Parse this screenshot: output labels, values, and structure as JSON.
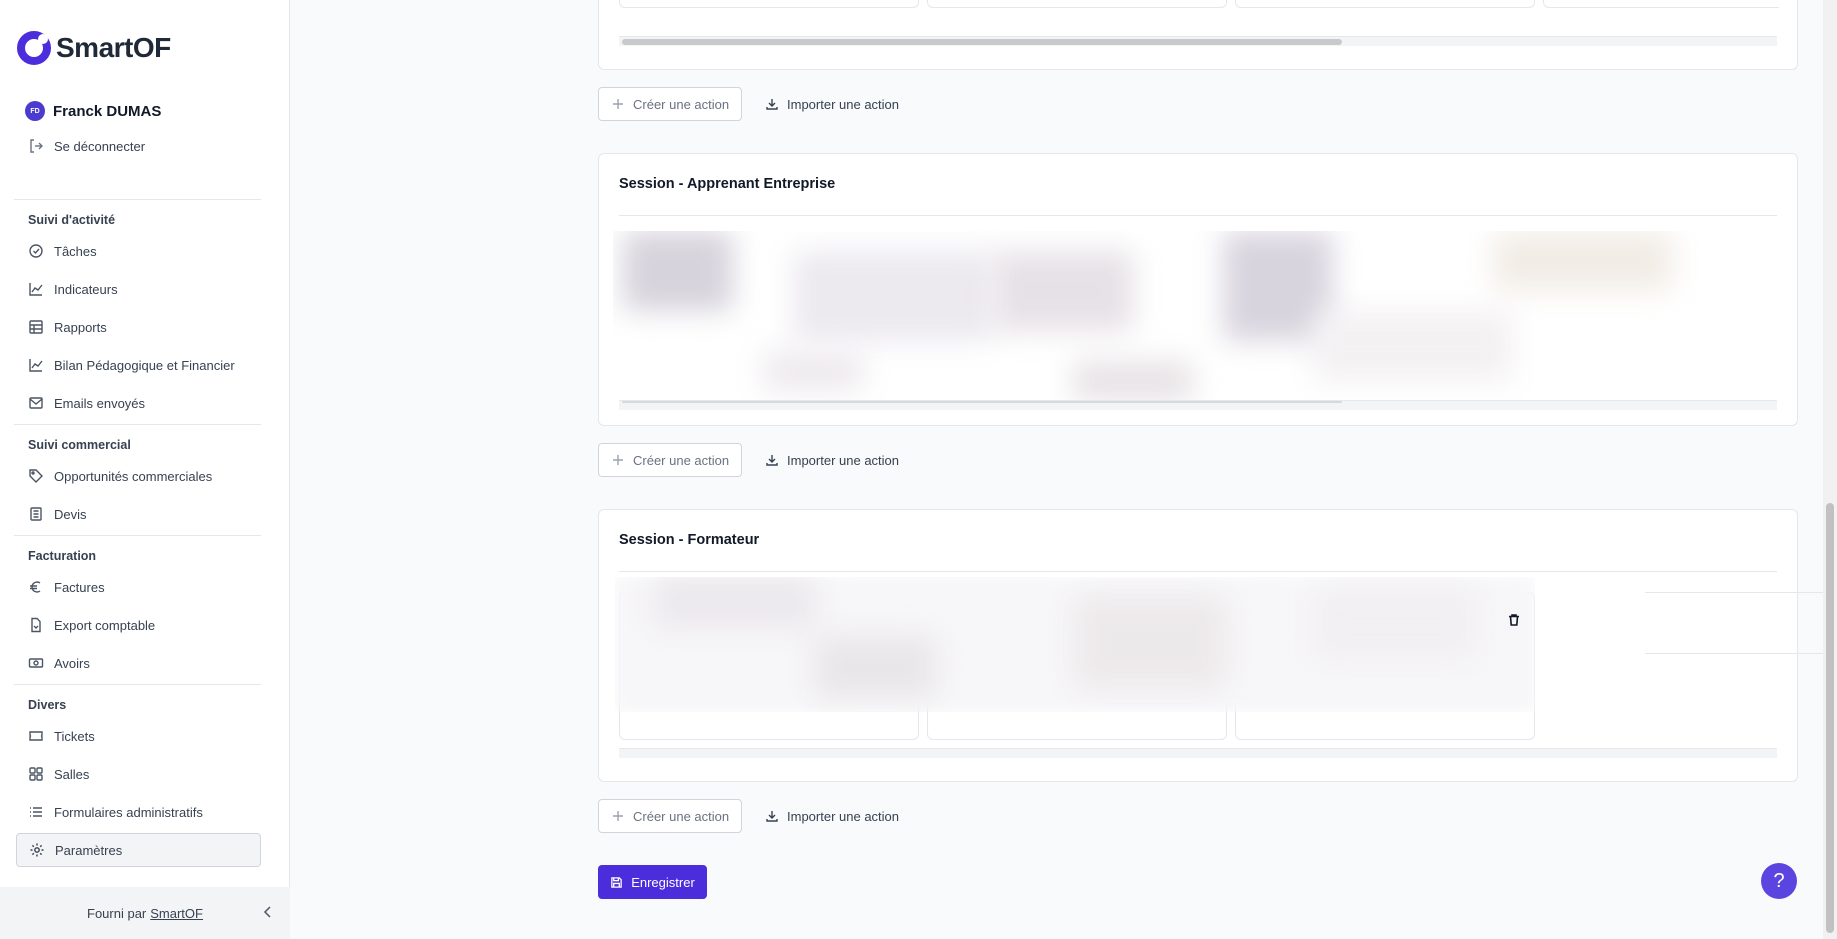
{
  "brand": {
    "name": "SmartOF",
    "accent": "#4c2ddc"
  },
  "user": {
    "initials": "FD",
    "name": "Franck DUMAS",
    "logout_label": "Se déconnecter"
  },
  "sidebar": {
    "sections": [
      {
        "title": "Suivi d'activité",
        "items": [
          {
            "label": "Tâches",
            "icon": "check-circle-icon"
          },
          {
            "label": "Indicateurs",
            "icon": "line-chart-icon"
          },
          {
            "label": "Rapports",
            "icon": "table-icon"
          },
          {
            "label": "Bilan Pédagogique et Financier",
            "icon": "line-chart-icon"
          },
          {
            "label": "Emails envoyés",
            "icon": "mail-icon"
          }
        ]
      },
      {
        "title": "Suivi commercial",
        "items": [
          {
            "label": "Opportunités commerciales",
            "icon": "tag-icon"
          },
          {
            "label": "Devis",
            "icon": "document-icon"
          }
        ]
      },
      {
        "title": "Facturation",
        "items": [
          {
            "label": "Factures",
            "icon": "euro-icon"
          },
          {
            "label": "Export comptable",
            "icon": "file-export-icon"
          },
          {
            "label": "Avoirs",
            "icon": "banknote-icon"
          }
        ]
      },
      {
        "title": "Divers",
        "items": [
          {
            "label": "Tickets",
            "icon": "ticket-icon"
          },
          {
            "label": "Salles",
            "icon": "grid-icon"
          },
          {
            "label": "Formulaires administratifs",
            "icon": "list-icon"
          },
          {
            "label": "Paramètres",
            "icon": "gear-icon",
            "active": true
          }
        ]
      }
    ],
    "footer": {
      "prefix": "Fourni par",
      "link": "SmartOF"
    }
  },
  "main": {
    "actions": {
      "create": "Créer une action",
      "import": "Importer une action"
    },
    "cards": [
      {
        "title": ""
      },
      {
        "title": "Session - Apprenant Entreprise"
      },
      {
        "title": "Session - Formateur"
      }
    ],
    "save_label": "Enregistrer",
    "help_label": "?"
  }
}
